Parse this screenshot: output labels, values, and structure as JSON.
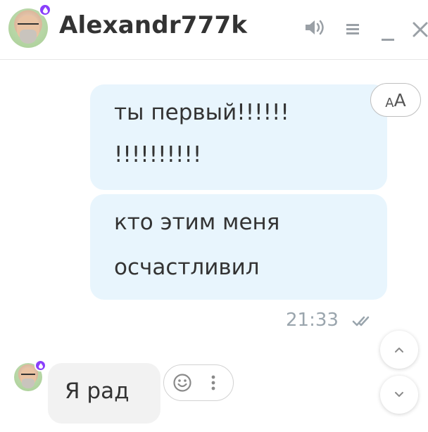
{
  "header": {
    "contact_name": "Alexandr777k",
    "badge_icon": "drop-icon",
    "icons": [
      "volume-icon",
      "menu-icon",
      "minimize-icon",
      "close-icon"
    ]
  },
  "messages": {
    "outgoing": [
      {
        "lines": [
          "ты первый!!!!!!",
          "!!!!!!!!!!"
        ]
      },
      {
        "lines": [
          "кто этим меня",
          "осчастливил"
        ]
      }
    ],
    "outgoing_time": "21:33",
    "incoming": [
      {
        "lines": [
          "Я рад"
        ]
      }
    ]
  },
  "font_toggle": {
    "small": "A",
    "big": "A"
  },
  "colors": {
    "outgoing_bubble": "#e8f5fd",
    "incoming_bubble": "#f2f2f2",
    "badge": "#8a3ffc",
    "meta_text": "#9aa5ad"
  }
}
